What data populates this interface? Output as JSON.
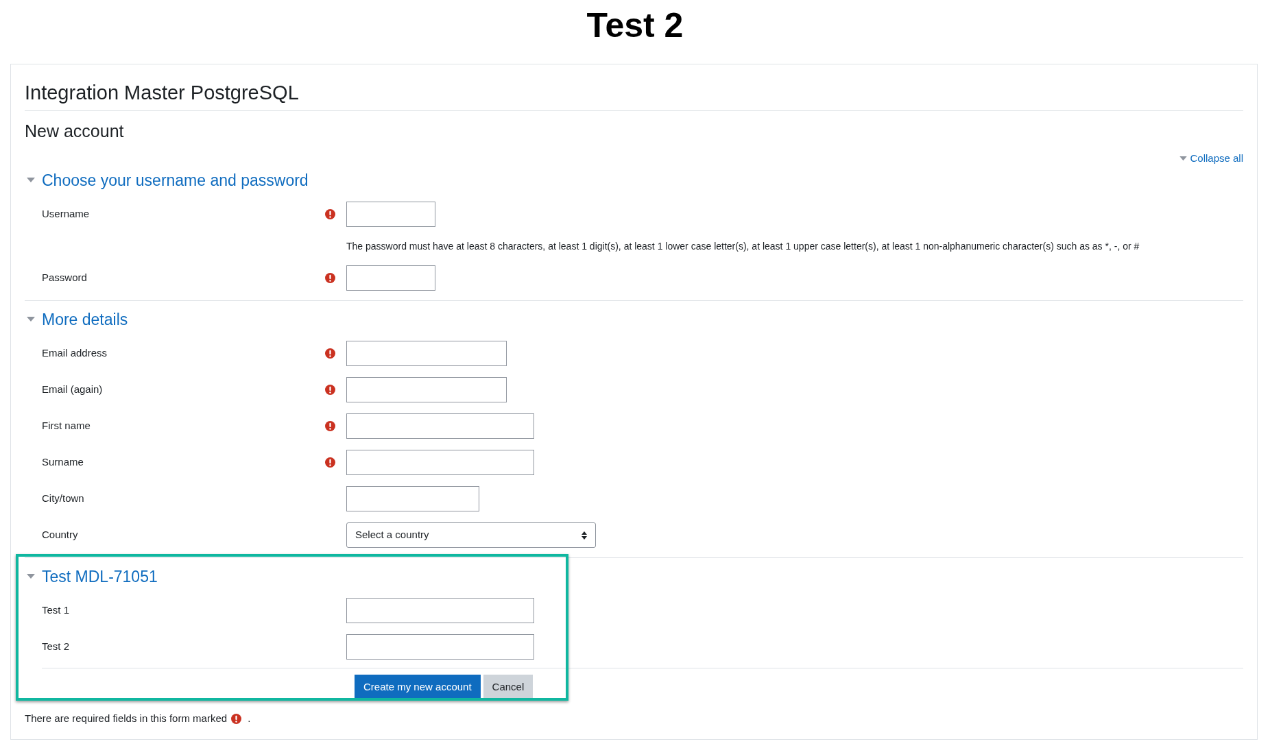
{
  "page_title": "Test 2",
  "site_name": "Integration Master PostgreSQL",
  "page_heading": "New account",
  "collapse_all": "Collapse all",
  "sections": [
    {
      "title": "Choose your username and password",
      "expanded": true,
      "highlighted": false,
      "fields": [
        {
          "kind": "text",
          "label": "Username",
          "required": true
        },
        {
          "kind": "note",
          "text": "The password must have at least 8 characters, at least 1 digit(s), at least 1 lower case letter(s), at least 1 upper case letter(s), at least 1 non-alphanumeric character(s) such as as *, -, or #"
        },
        {
          "kind": "text",
          "label": "Password",
          "required": true
        }
      ]
    },
    {
      "title": "More details",
      "expanded": true,
      "highlighted": false,
      "fields": [
        {
          "kind": "text",
          "label": "Email address",
          "required": true
        },
        {
          "kind": "text",
          "label": "Email (again)",
          "required": true
        },
        {
          "kind": "text",
          "label": "First name",
          "required": true
        },
        {
          "kind": "text",
          "label": "Surname",
          "required": true
        },
        {
          "kind": "text",
          "label": "City/town",
          "required": false
        },
        {
          "kind": "select",
          "label": "Country",
          "required": false,
          "value": "Select a country"
        }
      ]
    },
    {
      "title": "Test MDL-71051",
      "expanded": true,
      "highlighted": true,
      "fields": [
        {
          "kind": "text",
          "label": "Test 1",
          "required": false
        },
        {
          "kind": "text",
          "label": "Test 2",
          "required": false
        }
      ]
    }
  ],
  "buttons": [
    {
      "kind": "primary",
      "label": "Create my new account"
    },
    {
      "kind": "secondary",
      "label": "Cancel"
    }
  ],
  "footer": {
    "text_before": "There are required fields in this form marked",
    "text_after": "."
  }
}
